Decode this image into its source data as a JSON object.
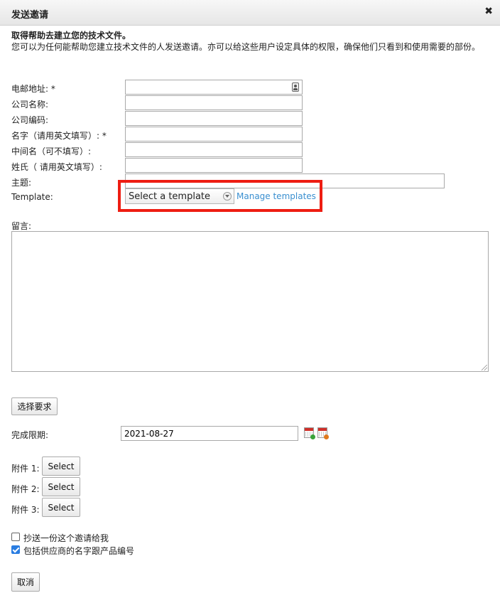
{
  "dialog": {
    "title": "发送邀请",
    "close_glyph": "✖"
  },
  "intro": {
    "heading": "取得帮助去建立您的技术文件。",
    "body": "您可以为任何能帮助您建立技术文件的人发送邀请。亦可以给这些用户设定具体的权限，确保他们只看到和使用需要的部份。"
  },
  "form": {
    "email_label": "电邮地址: *",
    "email_value": "",
    "company_name_label": "公司名称:",
    "company_name_value": "",
    "company_code_label": "公司编码:",
    "company_code_value": "",
    "first_name_label": "名字（请用英文填写）: *",
    "first_name_value": "",
    "middle_name_label": "中间名（可不填写）:",
    "middle_name_value": "",
    "last_name_label": "姓氏（ 请用英文填写）:",
    "last_name_value": "",
    "subject_label": "主题:",
    "subject_value": "",
    "template_label": "Template:",
    "template_selected": "Select a template",
    "manage_templates": "Manage templates",
    "message_label": "留言:",
    "message_value": "",
    "select_requirements_button": "选择要求",
    "deadline_label": "完成限期:",
    "deadline_value": "2021-08-27",
    "attachments": [
      {
        "label": "附件 1:",
        "button": "Select"
      },
      {
        "label": "附件 2:",
        "button": "Select"
      },
      {
        "label": "附件 3:",
        "button": "Select"
      }
    ],
    "cc_me_label": "抄送一份这个邀请给我",
    "cc_me_checked": false,
    "include_supplier_label": "包括供应商的名字跟产品编号",
    "include_supplier_checked": true,
    "cancel_button": "取消"
  },
  "colors": {
    "highlight": "#ee1d12",
    "link": "#3a8fd0",
    "checkbox_checked": "#2a7de1"
  },
  "icons": {
    "close": "close-icon",
    "contact": "contact-card-icon",
    "calendar_add": "calendar-add-icon",
    "calendar_remove": "calendar-remove-icon",
    "dropdown": "chevron-down-icon"
  }
}
